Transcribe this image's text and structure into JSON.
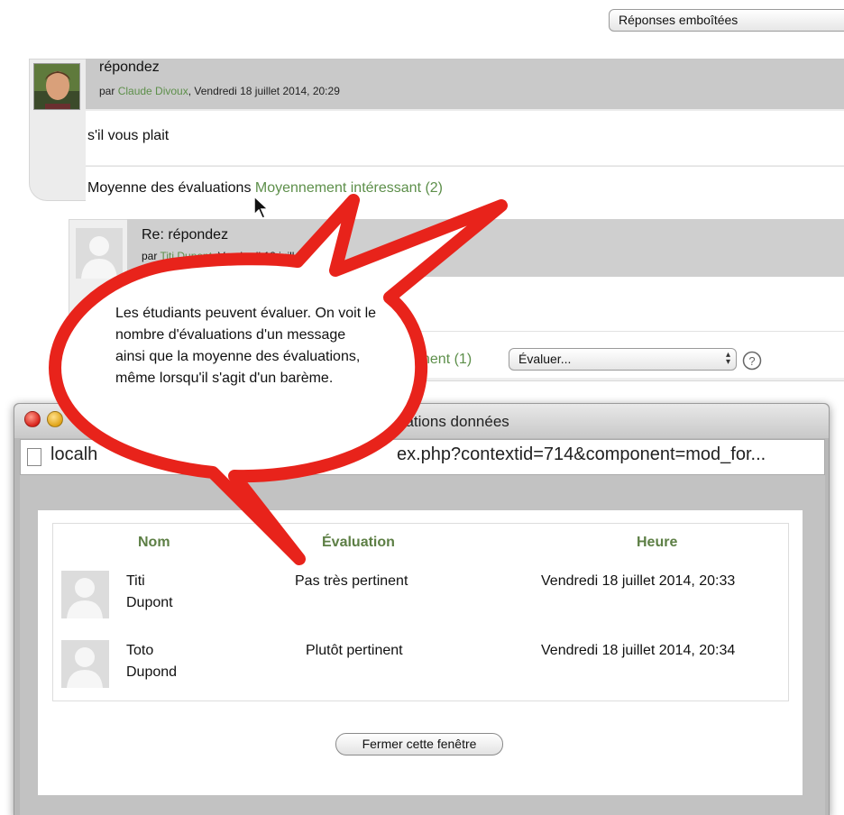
{
  "display_mode": {
    "selected": "Réponses emboîtées"
  },
  "post1": {
    "title": "répondez",
    "by_prefix": "par",
    "author": "Claude Divoux",
    "date": ", Vendredi 18 juillet 2014, 20:29",
    "message": "s'il vous plait",
    "rating_label": "Moyenne des évaluations",
    "rating_value": "Moyennement intéressant (2)"
  },
  "post2": {
    "title": "Re: répondez",
    "by_prefix": "par",
    "author": "Titi Dupont",
    "date": ", Vendredi 18 juillet 2014",
    "rating_value_partial": "tinent (1)",
    "rate_select": "Évaluer..."
  },
  "callout": {
    "text": "Les étudiants peuvent évaluer. On voit le nombre d'évaluations d'un message ainsi que la moyenne des évaluations, même lorsqu'il s'agit d'un barème."
  },
  "popup": {
    "title": "uations données",
    "url_left": "localh",
    "url_right": "ex.php?contextid=714&component=mod_for...",
    "table": {
      "headers": {
        "name": "Nom",
        "rating": "Évaluation",
        "time": "Heure"
      },
      "rows": [
        {
          "first": "Titi",
          "last": "Dupont",
          "rating": "Pas très pertinent",
          "time": "Vendredi 18 juillet 2014, 20:33"
        },
        {
          "first": "Toto",
          "last": "Dupond",
          "rating": "Plutôt pertinent",
          "time": "Vendredi 18 juillet 2014, 20:34"
        }
      ]
    },
    "close_label": "Fermer cette fenêtre"
  },
  "colors": {
    "link_green": "#5d8f4a",
    "callout_red": "#e8231b"
  }
}
